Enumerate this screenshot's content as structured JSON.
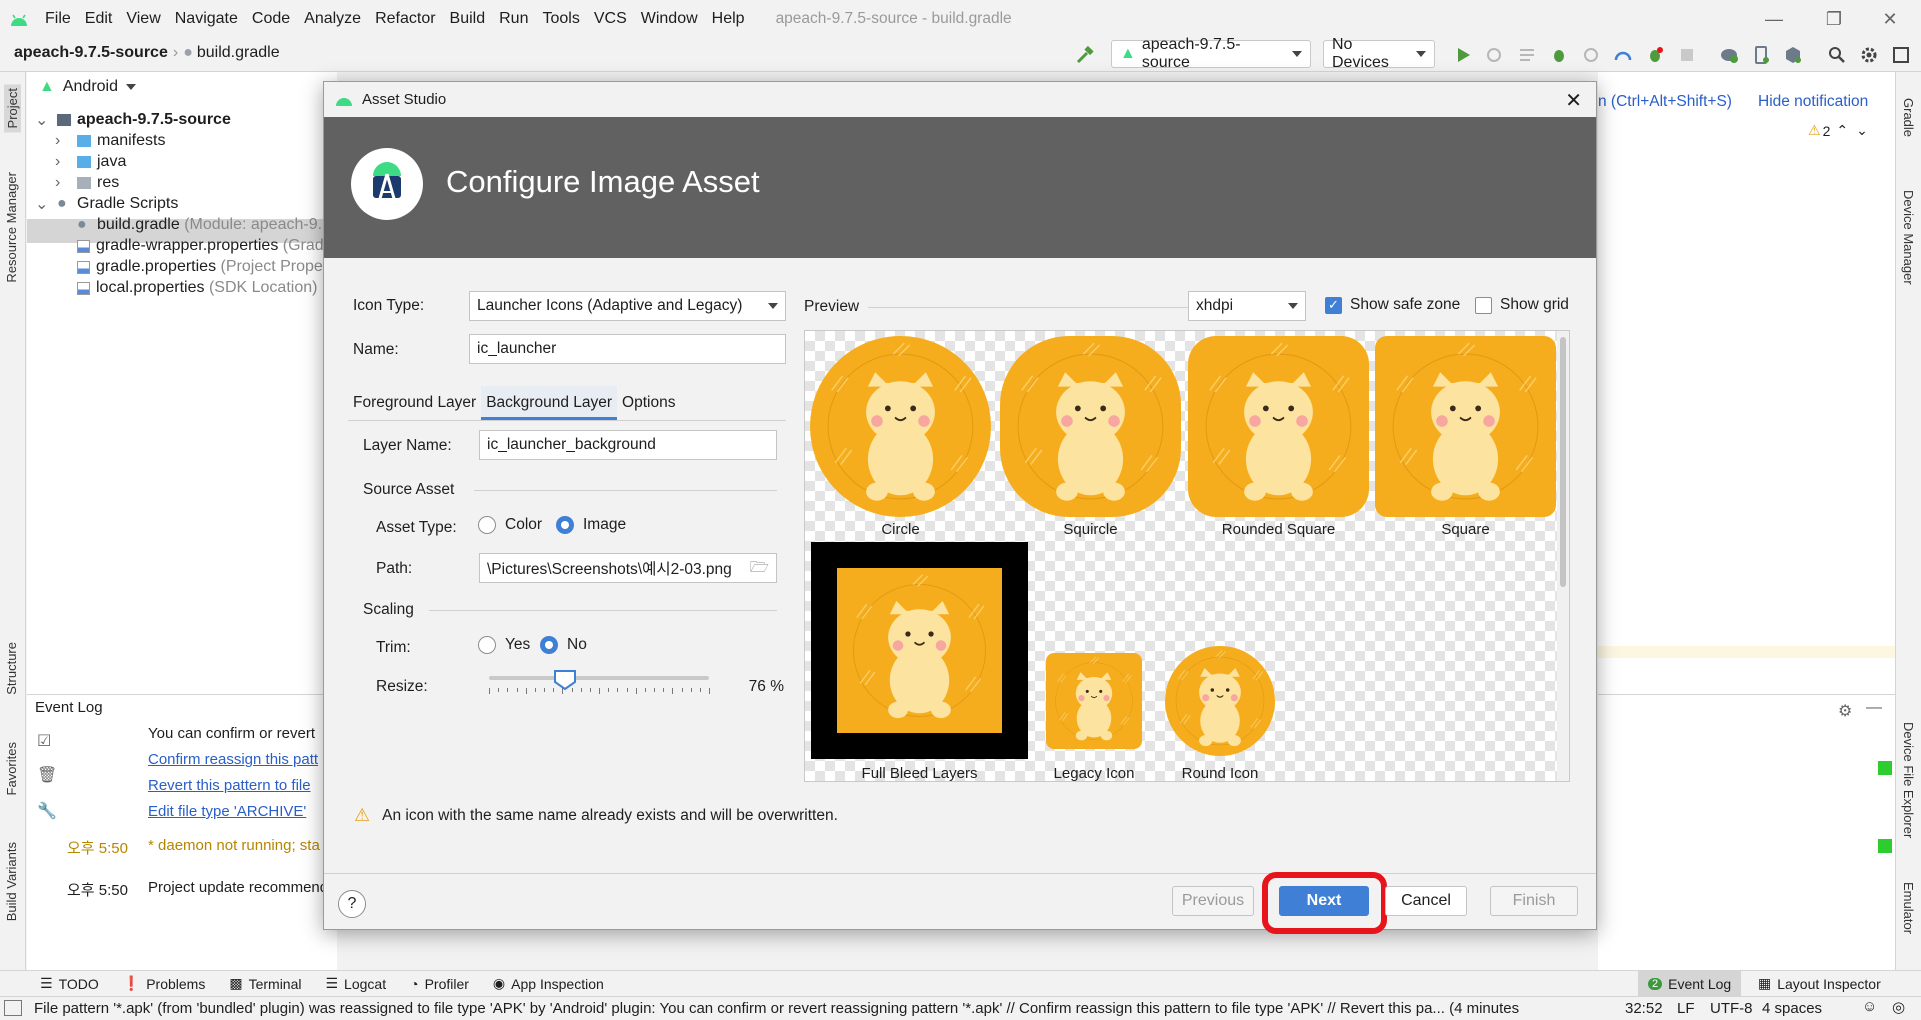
{
  "app": {
    "window_title": "apeach-9.7.5-source - build.gradle",
    "menu": [
      "File",
      "Edit",
      "View",
      "Navigate",
      "Code",
      "Analyze",
      "Refactor",
      "Build",
      "Run",
      "Tools",
      "VCS",
      "Window",
      "Help"
    ]
  },
  "navbar": {
    "breadcrumb_project": "apeach-9.7.5-source",
    "breadcrumb_file": "build.gradle",
    "run_config": "apeach-9.7.5-source",
    "device": "No Devices"
  },
  "left_stripe": {
    "project": "Project",
    "resource_manager": "Resource Manager",
    "structure": "Structure",
    "favorites": "Favorites",
    "build_variants": "Build Variants"
  },
  "right_stripe": {
    "gradle": "Gradle",
    "device_manager": "Device Manager",
    "device_file_explorer": "Device File Explorer",
    "emulator": "Emulator"
  },
  "project_panel": {
    "view": "Android",
    "tree": [
      {
        "label": "apeach-9.7.5-source",
        "extra": ""
      },
      {
        "label": "manifests",
        "extra": ""
      },
      {
        "label": "java",
        "extra": ""
      },
      {
        "label": "res",
        "extra": ""
      },
      {
        "label": "Gradle Scripts",
        "extra": ""
      },
      {
        "label": "build.gradle",
        "extra": "(Module: apeach-9."
      },
      {
        "label": "gradle-wrapper.properties",
        "extra": "(Grad"
      },
      {
        "label": "gradle.properties",
        "extra": "(Project Proper"
      },
      {
        "label": "local.properties",
        "extra": "(SDK Location)"
      }
    ]
  },
  "notification": {
    "shortcut": "n (Ctrl+Alt+Shift+S)",
    "hide": "Hide notification",
    "warnings": "2"
  },
  "event_log": {
    "title": "Event Log",
    "lines": [
      {
        "time": "",
        "text": "You can confirm or revert"
      },
      {
        "time": "",
        "text": "Confirm reassign this patt"
      },
      {
        "time": "",
        "text": "Revert this pattern to file"
      },
      {
        "time": "",
        "text": "Edit file type 'ARCHIVE'"
      },
      {
        "time": "오후 5:50",
        "text": "* daemon not running; sta"
      },
      {
        "time": "오후 5:50",
        "text": "Project update recommended: Android Gradle Plugin can be upgraded."
      }
    ]
  },
  "dialog": {
    "title": "Asset Studio",
    "header": "Configure Image Asset",
    "icon_type_label": "Icon Type:",
    "icon_type_value": "Launcher Icons (Adaptive and Legacy)",
    "name_label": "Name:",
    "name_value": "ic_launcher",
    "tabs": [
      "Foreground Layer",
      "Background Layer",
      "Options"
    ],
    "active_tab": "Background Layer",
    "layer_name_label": "Layer Name:",
    "layer_name_value": "ic_launcher_background",
    "source_asset_label": "Source Asset",
    "asset_type_label": "Asset Type:",
    "asset_type_color": "Color",
    "asset_type_image": "Image",
    "path_label": "Path:",
    "path_value": "\\Pictures\\Screenshots\\예시2-03.png",
    "scaling_label": "Scaling",
    "trim_label": "Trim:",
    "trim_yes": "Yes",
    "trim_no": "No",
    "resize_label": "Resize:",
    "resize_value": "76 %",
    "resize_fraction": 0.76,
    "preview_label": "Preview",
    "density": "xhdpi",
    "show_safe_zone": "Show safe zone",
    "show_grid": "Show grid",
    "previews": [
      "Circle",
      "Squircle",
      "Rounded Square",
      "Square",
      "Full Bleed Layers",
      "Legacy Icon",
      "Round Icon"
    ],
    "warning": "An icon with the same name already exists and will be overwritten.",
    "help": "?",
    "buttons": {
      "previous": "Previous",
      "next": "Next",
      "cancel": "Cancel",
      "finish": "Finish"
    }
  },
  "bottom_tools": [
    "TODO",
    "Problems",
    "Terminal",
    "Logcat",
    "Profiler",
    "App Inspection"
  ],
  "bottom_right_tools": {
    "event_log_count": "2",
    "event_log": "Event Log",
    "layout_inspector": "Layout Inspector"
  },
  "status": {
    "message": "File pattern '*.apk' (from 'bundled' plugin) was reassigned to file type 'APK' by 'Android' plugin: You can confirm or revert reassigning pattern '*.apk' // Confirm reassign this pattern to file type 'APK' // Revert this pa... (4 minutes",
    "position": "32:52",
    "line_sep": "LF",
    "encoding": "UTF-8",
    "indent": "4 spaces"
  },
  "colors": {
    "accent": "#3f7fd5",
    "highlight_ring": "#e8141c",
    "preview_orange": "#f6ad1d",
    "bear": "#fde3a0"
  }
}
